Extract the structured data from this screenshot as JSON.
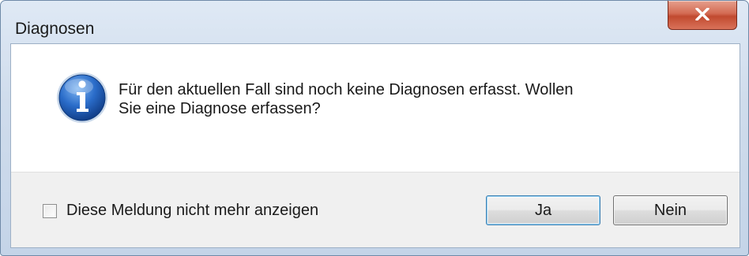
{
  "window": {
    "title": "Diagnosen"
  },
  "message": {
    "line1": "Für den aktuellen Fall sind noch keine Diagnosen erfasst. Wollen",
    "line2": "Sie eine Diagnose erfassen?"
  },
  "icon": {
    "type": "information-icon"
  },
  "footer": {
    "checkbox_label": "Diese Meldung nicht mehr anzeigen",
    "checkbox_checked": false,
    "yes_label": "Ja",
    "no_label": "Nein"
  },
  "colors": {
    "close_button": "#c14a2f",
    "info_icon": "#1f5fb8",
    "footer_bg": "#f0f0f0"
  }
}
